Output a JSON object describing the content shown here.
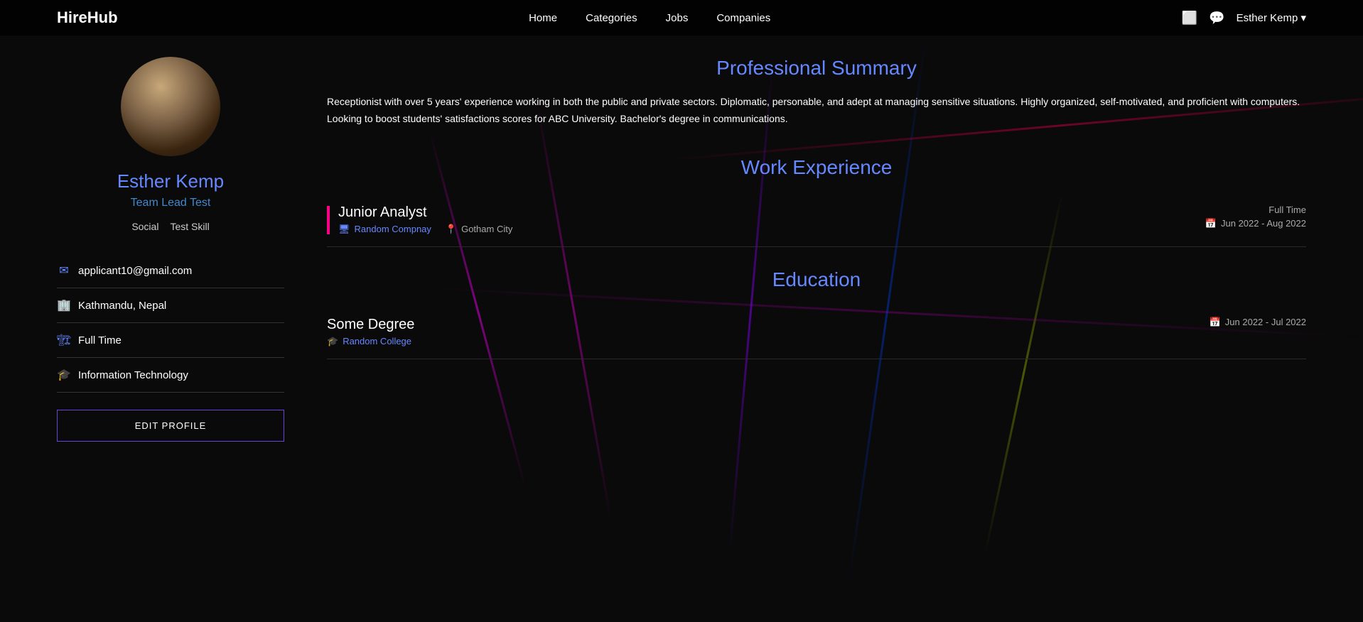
{
  "app": {
    "logo": "HireHub"
  },
  "nav": {
    "links": [
      {
        "label": "Home",
        "href": "#"
      },
      {
        "label": "Categories",
        "href": "#"
      },
      {
        "label": "Jobs",
        "href": "#"
      },
      {
        "label": "Companies",
        "href": "#"
      }
    ],
    "user": "Esther Kemp ▾"
  },
  "profile": {
    "name": "Esther Kemp",
    "role": "Team Lead Test",
    "tags": [
      "Social",
      "Test Skill"
    ],
    "email": "applicant10@gmail.com",
    "location": "Kathmandu, Nepal",
    "job_type": "Full Time",
    "industry": "Information Technology",
    "edit_button": "EDIT PROFILE"
  },
  "summary": {
    "section_title": "Professional Summary",
    "text": "Receptionist with over 5 years' experience working in both the public and private sectors. Diplomatic, personable, and adept at managing sensitive situations. Highly organized, self-motivated, and proficient with computers. Looking to boost students' satisfactions scores for ABC University. Bachelor's degree in communications."
  },
  "work_experience": {
    "section_title": "Work Experience",
    "items": [
      {
        "title": "Junior Analyst",
        "company": "Random Compnay",
        "location": "Gotham City",
        "type": "Full Time",
        "dates": "Jun 2022 - Aug 2022"
      }
    ]
  },
  "education": {
    "section_title": "Education",
    "items": [
      {
        "degree": "Some Degree",
        "institution": "Random College",
        "dates": "Jun 2022 - Jul 2022"
      }
    ]
  }
}
